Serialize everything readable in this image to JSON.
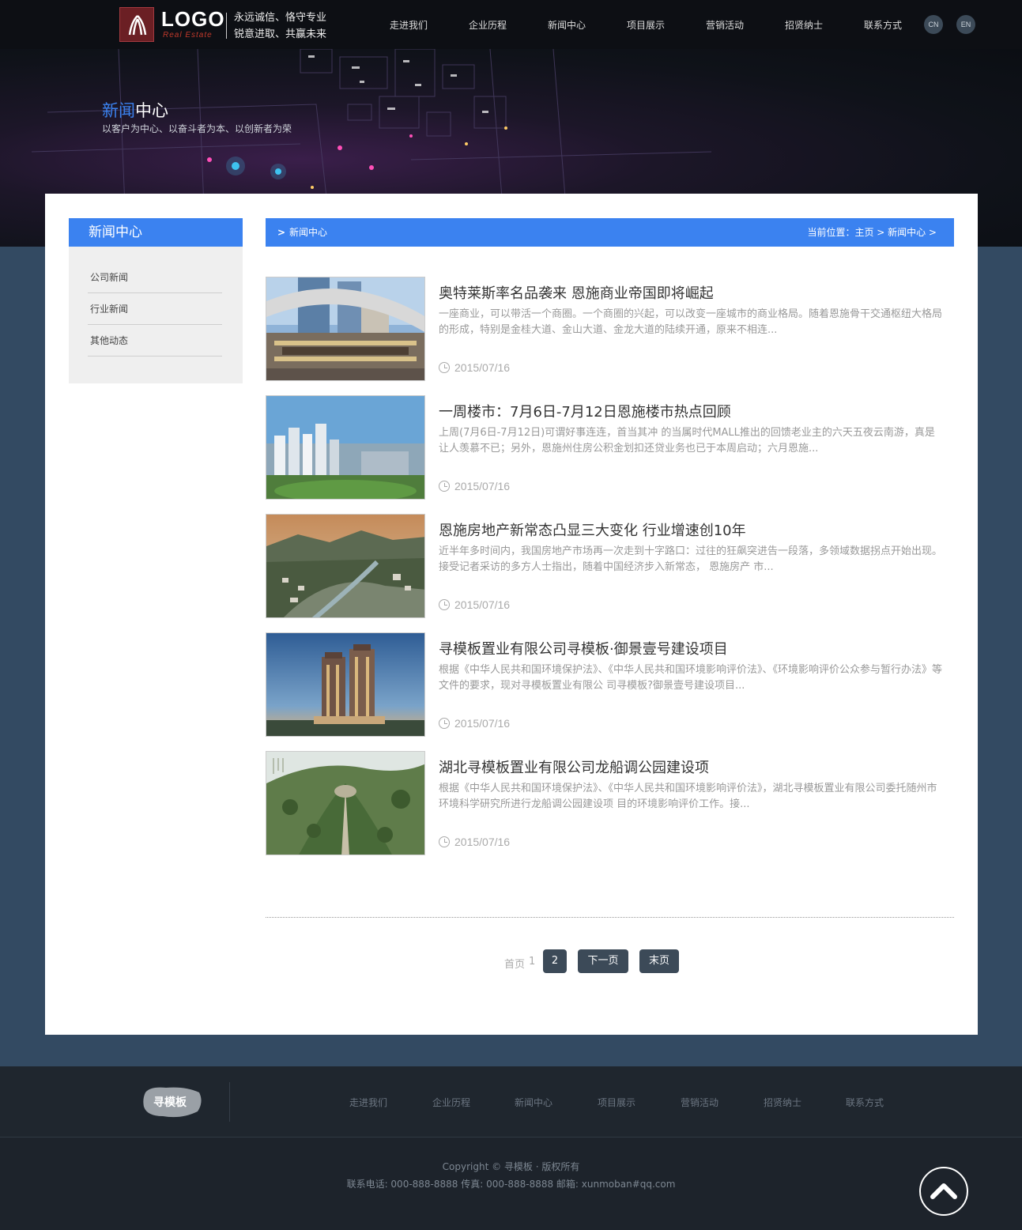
{
  "header": {
    "logo_text": "LOGO",
    "logo_sub": "Real Estate",
    "slogan_line1": "永远诚信、恪守专业",
    "slogan_line2": "锐意进取、共赢未来",
    "nav": [
      "走进我们",
      "企业历程",
      "新闻中心",
      "项目展示",
      "营销活动",
      "招贤纳士",
      "联系方式"
    ],
    "lang_cn": "CN",
    "lang_en": "EN"
  },
  "banner": {
    "title_highlight": "新闻",
    "title_rest": "中心",
    "subtitle": "以客户为中心、以奋斗者为本、以创新者为荣"
  },
  "sidebar": {
    "title": "新闻中心",
    "items": [
      "公司新闻",
      "行业新闻",
      "其他动态"
    ]
  },
  "crumb": {
    "arrow": ">",
    "title": "新闻中心",
    "location": "当前位置：主页 > 新闻中心 >"
  },
  "news": [
    {
      "title": "奥特莱斯率名品袭来 恩施商业帝国即将崛起",
      "desc": "一座商业，可以带活一个商圈。一个商圈的兴起，可以改变一座城市的商业格局。随着恩施骨干交通枢纽大格局的形成，特别是金桂大道、金山大道、金龙大道的陆续开通，原来不相连...",
      "date": "2015/07/16",
      "image": "shopping-mall"
    },
    {
      "title": "一周楼市：7月6日-7月12日恩施楼市热点回顾",
      "desc": "上周(7月6日-7月12日)可谓好事连连，首当其冲 的当属时代MALL推出的回馈老业主的六天五夜云南游，真是让人羡慕不已；另外，恩施州住房公积金划扣还贷业务也已于本周启动；六月恩施...",
      "date": "2015/07/16",
      "image": "city-towers"
    },
    {
      "title": "恩施房地产新常态凸显三大变化 行业增速创10年",
      "desc": "近半年多时间内，我国房地产市场再一次走到十字路口：过往的狂飙突进告一段落，多领域数据拐点开始出现。接受记者采访的多方人士指出，随着中国经济步入新常态， 恩施房产 市...",
      "date": "2015/07/16",
      "image": "mountain-city"
    },
    {
      "title": "寻模板置业有限公司寻模板·御景壹号建设项目",
      "desc": "根据《中华人民共和国环境保护法》、《中华人民共和国环境影响评价法》、《环境影响评价公众参与暂行办法》等文件的要求，现对寻模板置业有限公 司寻模板?御景壹号建设项目...",
      "date": "2015/07/16",
      "image": "high-rise-dusk"
    },
    {
      "title": "湖北寻模板置业有限公司龙船调公园建设项",
      "desc": "根据《中华人民共和国环境保护法》、《中华人民共和国环境影响评价法》，湖北寻模板置业有限公司委托随州市环境科学研究所进行龙船调公园建设项 目的环境影响评价工作。接...",
      "date": "2015/07/16",
      "image": "park-aerial"
    }
  ],
  "pager": {
    "first": "首页",
    "current": "1",
    "page2": "2",
    "next": "下一页",
    "last": "末页"
  },
  "footer": {
    "logo_text": "寻模板",
    "nav": [
      "走进我们",
      "企业历程",
      "新闻中心",
      "项目展示",
      "营销活动",
      "招贤纳士",
      "联系方式"
    ],
    "copyright": "Copyright ©  寻模板 · 版权所有",
    "contact": "联系电话: 000-888-8888 传真: 000-888-8888 邮箱: xunmoban#qq.com"
  },
  "colors": {
    "accent": "#3b82f0",
    "background": "#334a62",
    "header": "#0d0f14",
    "footer": "#1d232b",
    "button": "#3c4a58"
  },
  "icons": [
    "logo-emblem-icon",
    "chevron-right-icon",
    "clock-icon",
    "back-to-top-icon"
  ]
}
